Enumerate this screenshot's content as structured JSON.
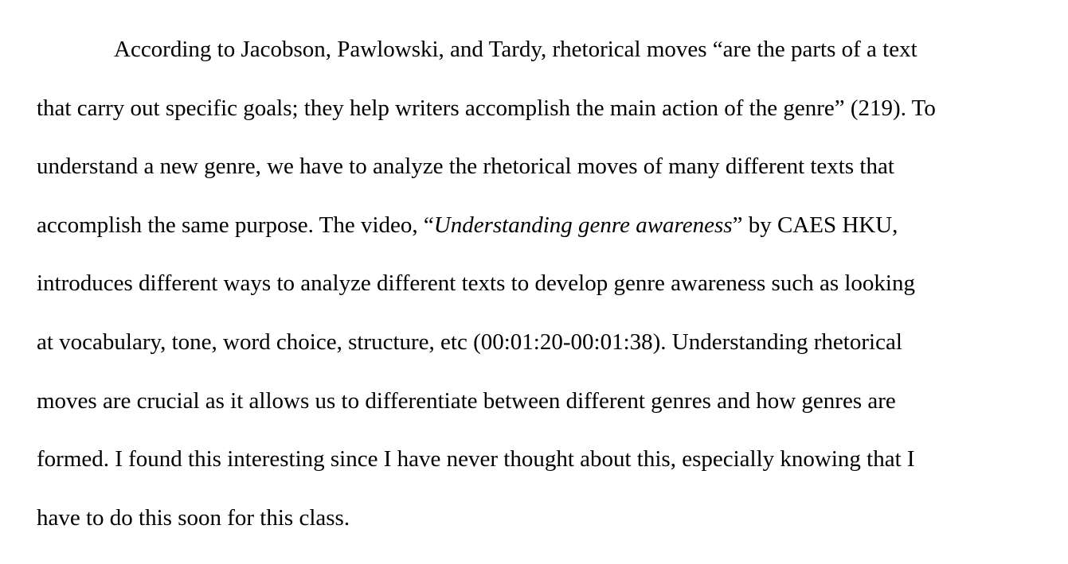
{
  "paragraph": {
    "line1": "According to Jacobson, Pawlowski, and Tardy, rhetorical moves “are the parts of a text",
    "line2": "that carry out specific goals; they help writers accomplish the main action of the genre” (219). To",
    "line3": "understand a new genre, we have to analyze the rhetorical moves of many different texts that",
    "line4_before": "accomplish the same purpose. The video, “",
    "line4_italic": "Understanding genre awareness",
    "line4_after": "” by CAES HKU,",
    "line5": "introduces different ways to analyze different texts to develop genre awareness such as looking",
    "line6": "at vocabulary, tone, word choice, structure, etc (00:01:20-00:01:38). Understanding rhetorical",
    "line7": "moves are crucial as it allows us to differentiate between different genres and how genres are",
    "line8": "formed. I found this interesting since I have never thought about this, especially knowing that I",
    "line9": "have to do this soon for this class."
  }
}
